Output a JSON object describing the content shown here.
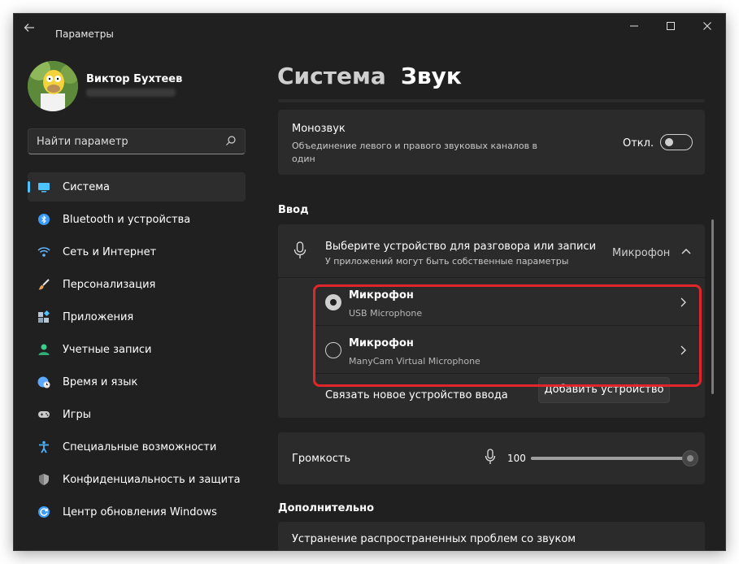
{
  "window": {
    "title": "Параметры",
    "back_icon": "arrow-left-icon",
    "controls": [
      "minimize-icon",
      "maximize-icon",
      "close-icon"
    ]
  },
  "profile": {
    "name": "Виктор Бухтеев"
  },
  "search": {
    "placeholder": "Найти параметр",
    "icon": "search-icon"
  },
  "sidebar": {
    "items": [
      {
        "label": "Система",
        "icon": "display-icon",
        "color": "#4cc2ff",
        "active": true
      },
      {
        "label": "Bluetooth и устройства",
        "icon": "bluetooth-icon",
        "color": "#3a9bff"
      },
      {
        "label": "Сеть и Интернет",
        "icon": "wifi-icon",
        "color": "#5fb7ff"
      },
      {
        "label": "Персонализация",
        "icon": "brush-icon",
        "color": "#e6a35c"
      },
      {
        "label": "Приложения",
        "icon": "apps-icon",
        "color": "#b9c6d6"
      },
      {
        "label": "Учетные записи",
        "icon": "person-icon",
        "color": "#3ccc8a"
      },
      {
        "label": "Время и язык",
        "icon": "globe-clock-icon",
        "color": "#5aa8ff"
      },
      {
        "label": "Игры",
        "icon": "gamepad-icon",
        "color": "#c9c9c9"
      },
      {
        "label": "Специальные возможности",
        "icon": "accessibility-icon",
        "color": "#4ab3ff"
      },
      {
        "label": "Конфиденциальность и защита",
        "icon": "shield-icon",
        "color": "#a7a7a7"
      },
      {
        "label": "Центр обновления Windows",
        "icon": "update-icon",
        "color": "#3a9bff"
      }
    ]
  },
  "breadcrumb": {
    "parent": "Система",
    "separator": "›",
    "current": "Звук"
  },
  "mono": {
    "title": "Монозвук",
    "description": "Объединение левого и правого звуковых каналов в один",
    "toggle_label": "Откл.",
    "enabled": false
  },
  "input_section": {
    "title": "Ввод",
    "device_picker": {
      "title": "Выберите устройство для разговора или записи",
      "subtitle": "У приложений могут быть собственные параметры",
      "selected": "Микрофон"
    },
    "devices": [
      {
        "name": "Микрофон",
        "detail": "USB Microphone",
        "selected": true
      },
      {
        "name": "Микрофон",
        "detail": "ManyCam Virtual Microphone",
        "selected": false
      }
    ],
    "pair_label": "Связать новое устройство ввода",
    "add_button": "Добавить устройство",
    "highlight_color": "#e0262a"
  },
  "volume": {
    "label": "Громкость",
    "value": "100",
    "level": 100
  },
  "extra_section": {
    "title": "Дополнительно",
    "troubleshoot": "Устранение распространенных проблем со звуком"
  }
}
